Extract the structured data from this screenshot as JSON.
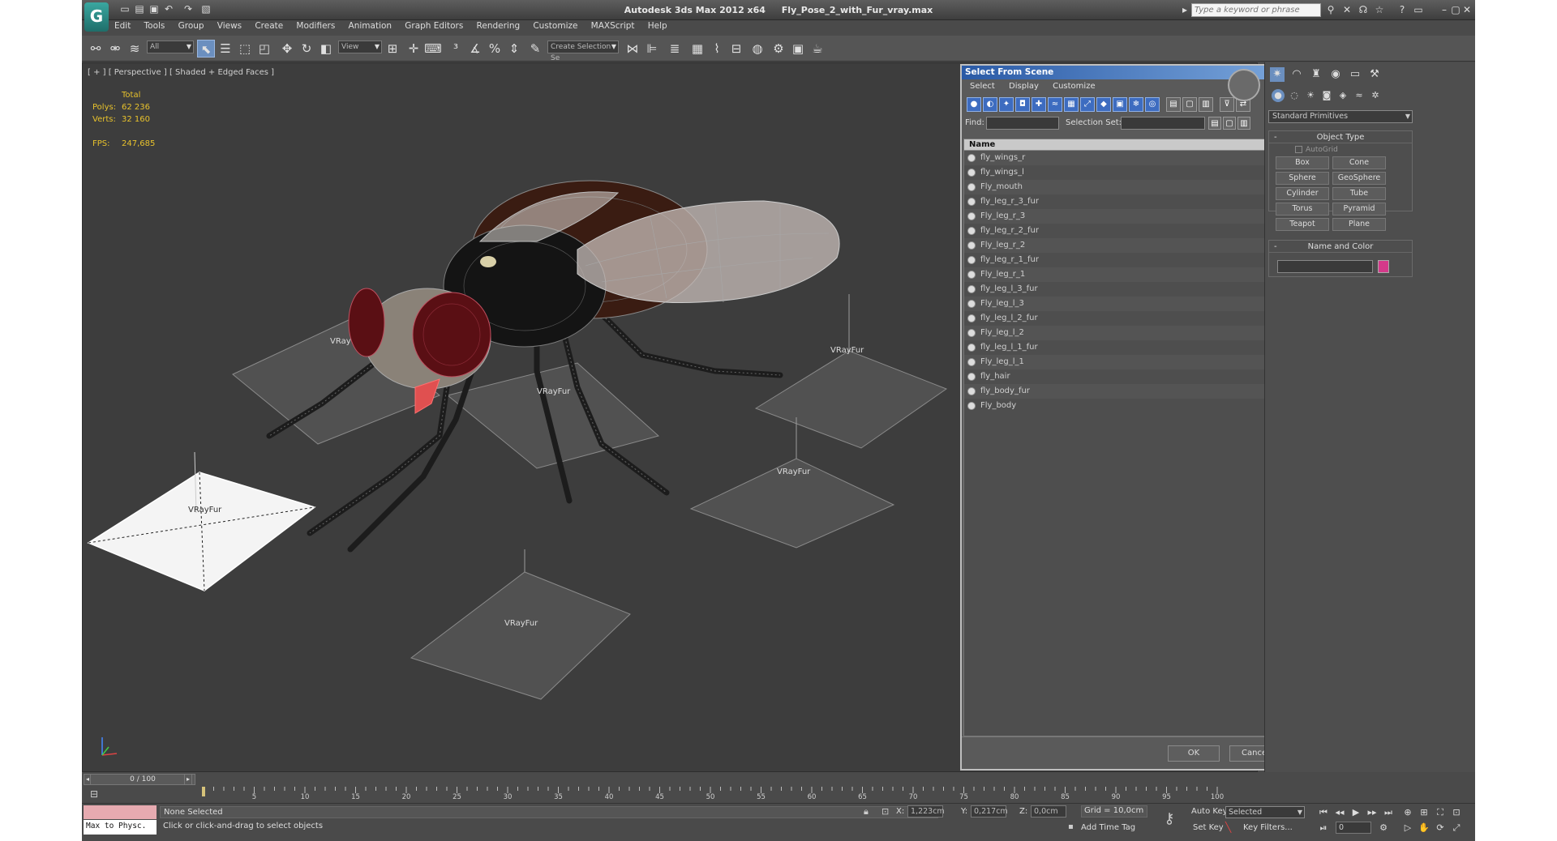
{
  "window": {
    "app_name": "Autodesk 3ds Max  2012 x64",
    "file_name": "Fly_Pose_2_with_Fur_vray.max",
    "search_placeholder": "Type a keyword or phrase",
    "logo_glyph": "G"
  },
  "menu": [
    "Edit",
    "Tools",
    "Group",
    "Views",
    "Create",
    "Modifiers",
    "Animation",
    "Graph Editors",
    "Rendering",
    "Customize",
    "MAXScript",
    "Help"
  ],
  "toolbar": {
    "selection_filter": "All",
    "ref_coord": "View",
    "named_selection": "Create Selection Se"
  },
  "viewport": {
    "label": "[ + ] [ Perspective ] [ Shaded + Edged Faces ]",
    "stats_header": "Total",
    "polys_label": "Polys:",
    "polys_value": "62 236",
    "verts_label": "Verts:",
    "verts_value": "32 160",
    "fps_label": "FPS:",
    "fps_value": "247,685",
    "object_labels": [
      "VRay",
      "VRayFur",
      "VRayFur",
      "VRayFur",
      "VRayFur",
      "VRayFur"
    ]
  },
  "dialog": {
    "title": "Select From Scene",
    "menu": [
      "Select",
      "Display",
      "Customize"
    ],
    "find_label": "Find:",
    "selection_set_label": "Selection Set:",
    "column_header": "Name",
    "items": [
      "fly_wings_r",
      "fly_wings_l",
      "Fly_mouth",
      "fly_leg_r_3_fur",
      "Fly_leg_r_3",
      "fly_leg_r_2_fur",
      "Fly_leg_r_2",
      "fly_leg_r_1_fur",
      "Fly_leg_r_1",
      "fly_leg_l_3_fur",
      "Fly_leg_l_3",
      "fly_leg_l_2_fur",
      "Fly_leg_l_2",
      "fly_leg_l_1_fur",
      "Fly_leg_l_1",
      "fly_hair",
      "fly_body_fur",
      "Fly_body"
    ],
    "ok_label": "OK",
    "cancel_label": "Cancel"
  },
  "command_panel": {
    "primitive_type": "Standard Primitives",
    "object_type_title": "Object Type",
    "autogrid_label": "AutoGrid",
    "primitives": [
      "Box",
      "Cone",
      "Sphere",
      "GeoSphere",
      "Cylinder",
      "Tube",
      "Torus",
      "Pyramid",
      "Teapot",
      "Plane"
    ],
    "name_color_title": "Name and Color",
    "object_color": "#d43a8a"
  },
  "timeline": {
    "slider": "0 / 100",
    "ticks": [
      "5",
      "10",
      "15",
      "20",
      "25",
      "30",
      "35",
      "40",
      "45",
      "50",
      "55",
      "60",
      "65",
      "70",
      "75",
      "80",
      "85",
      "90",
      "95",
      "100"
    ]
  },
  "status": {
    "maxscript": "Max to Physc.",
    "selection": "None Selected",
    "prompt": "Click or click-and-drag to select objects",
    "x_label": "X:",
    "x_value": "1,223cm",
    "y_label": "Y:",
    "y_value": "0,217cm",
    "z_label": "Z:",
    "z_value": "0,0cm",
    "grid": "Grid = 10,0cm",
    "add_time_tag": "Add Time Tag",
    "auto_key": "Auto Key",
    "key_mode": "Selected",
    "set_key": "Set Key",
    "key_filters": "Key Filters...",
    "frame": "0"
  }
}
